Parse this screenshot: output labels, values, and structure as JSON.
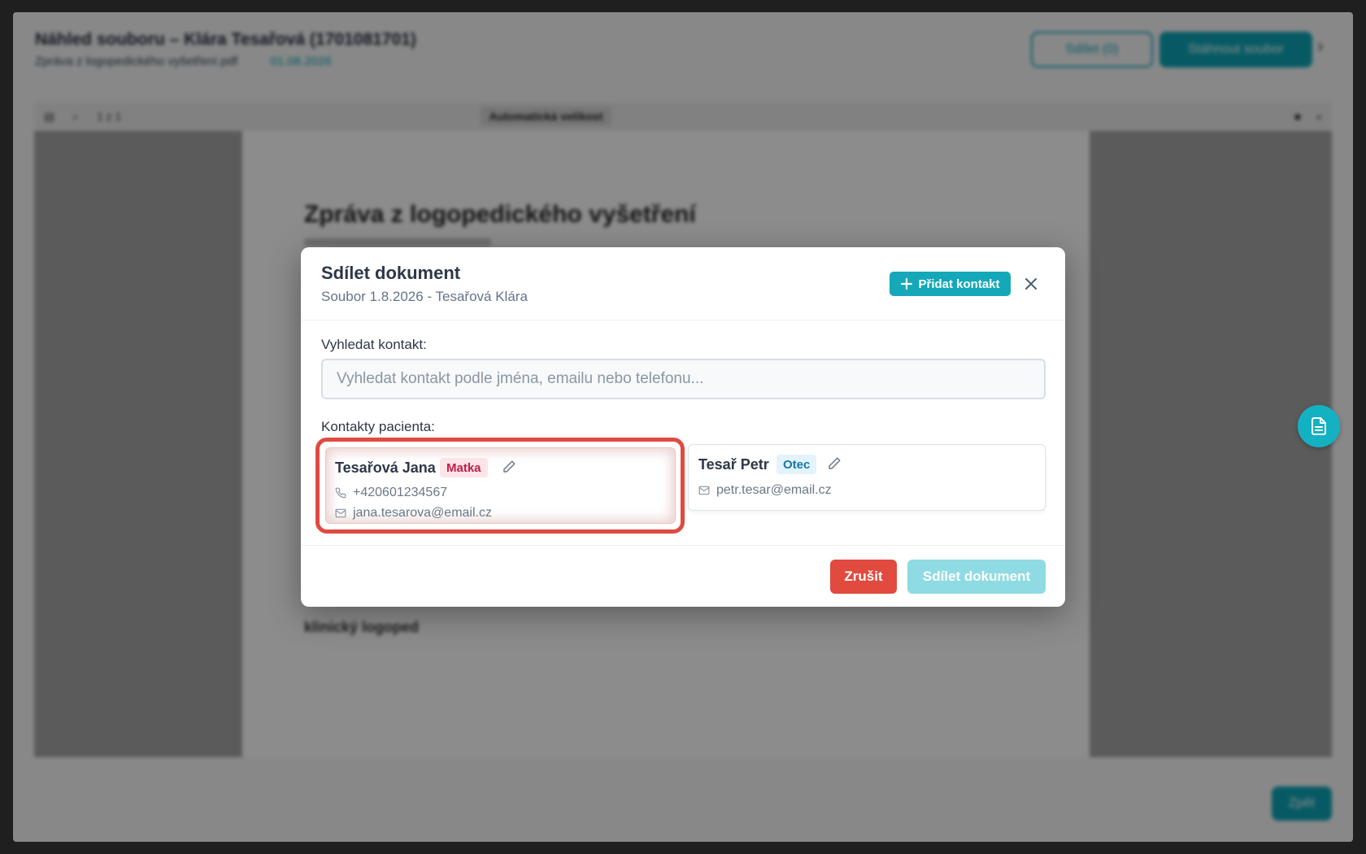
{
  "background": {
    "title": "Náhled souboru – Klára Tesařová (1701081701)",
    "subtitle_file": "Zpráva z logopedického vyšetření.pdf",
    "subtitle_date": "01.08.2026",
    "outline_button": "Sdílet  (0)",
    "primary_button": "Stáhnout soubor",
    "page_indicator": "1  z 1",
    "zoom_label": "Automatická velikost",
    "document_heading": "Zpráva z logopedického vyšetření",
    "document_signature": "klinický logoped",
    "bottom_button": "Zpět"
  },
  "modal": {
    "title": "Sdílet dokument",
    "subtitle": "Soubor 1.8.2026 - Tesařová Klára",
    "add_contact_label": "Přidat kontakt",
    "search_label": "Vyhledat kontakt:",
    "search_placeholder": "Vyhledat kontakt podle jména, emailu nebo telefonu...",
    "contacts_label": "Kontakty pacienta:",
    "contacts": [
      {
        "name": "Tesařová Jana",
        "role": "Matka",
        "phone": "+420601234567",
        "email": "jana.tesarova@email.cz"
      },
      {
        "name": "Tesař Petr",
        "role": "Otec",
        "email": "petr.tesar@email.cz"
      }
    ],
    "cancel_label": "Zrušit",
    "share_label": "Sdílet dokument"
  },
  "colors": {
    "accent": "#14a8b8",
    "danger": "#e04a3f",
    "mother_badge": "#be1e4a",
    "father_badge": "#1577a8"
  },
  "icons": [
    "plus-icon",
    "close-icon",
    "edit-icon",
    "phone-icon",
    "mail-icon",
    "document-icon"
  ]
}
